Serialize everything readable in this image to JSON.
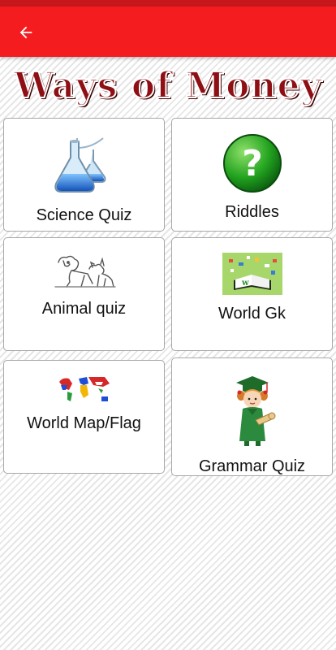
{
  "app_bar": {
    "back_icon": "arrow-left-icon",
    "color": "#f51c20",
    "status_color": "#c8161d"
  },
  "banner": {
    "title": "Ways of Money",
    "color": "#8e0f14"
  },
  "categories": [
    {
      "label": "Science Quiz",
      "icon": "flask-icon"
    },
    {
      "label": "Riddles",
      "icon": "question-mark-icon"
    },
    {
      "label": "Animal quiz",
      "icon": "animals-sketch-icon"
    },
    {
      "label": "World Gk",
      "icon": "open-book-icon"
    },
    {
      "label": "World Map/Flag",
      "icon": "flag-world-map-icon"
    },
    {
      "label": "Grammar Quiz",
      "icon": "graduate-girl-icon"
    }
  ]
}
